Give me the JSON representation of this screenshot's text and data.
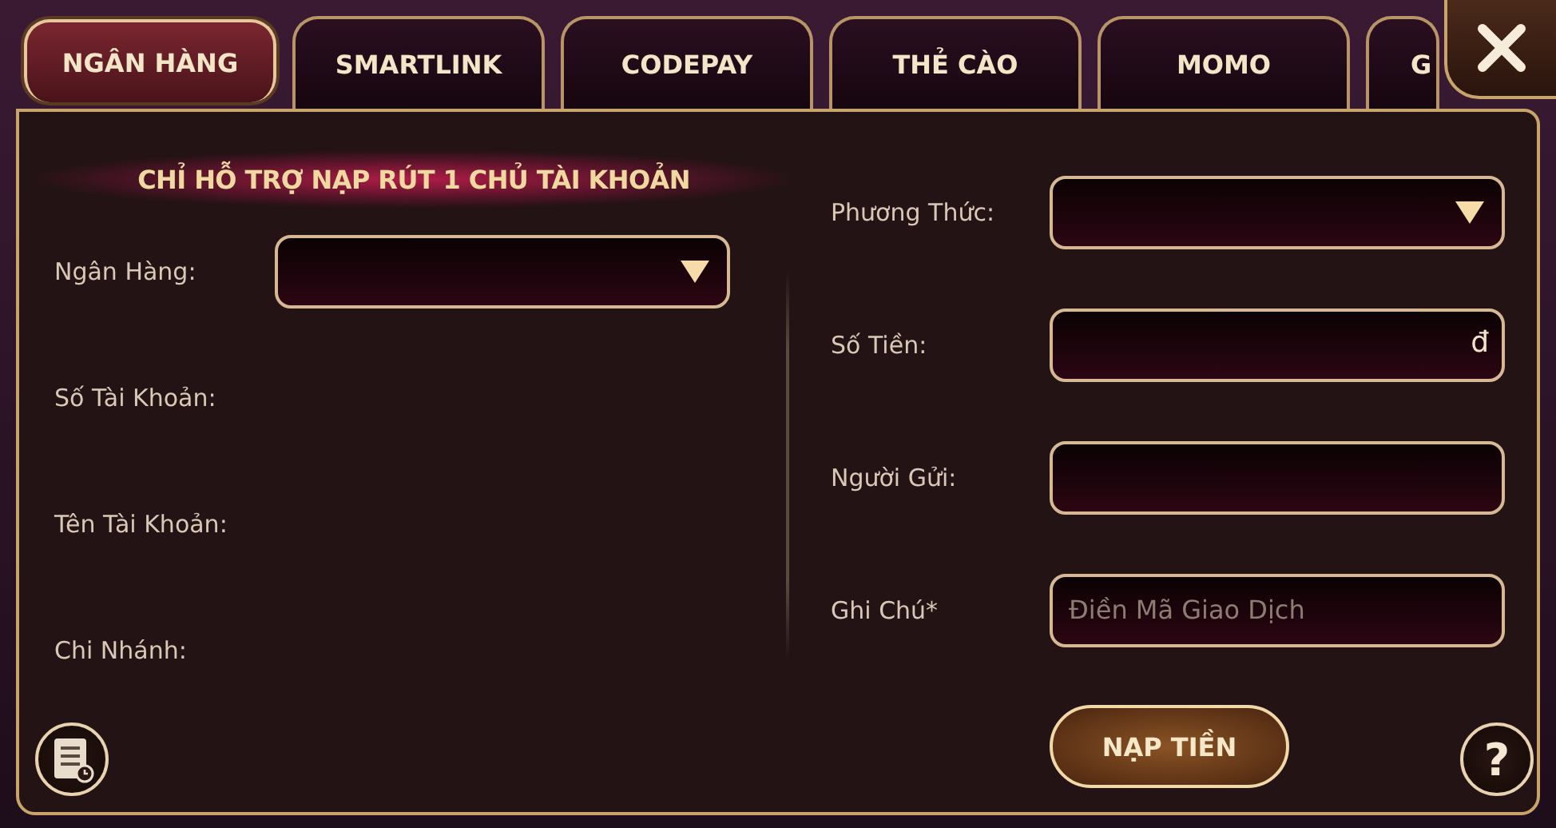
{
  "tabs": [
    {
      "label": "NGÂN HÀNG",
      "selected": true
    },
    {
      "label": "SMARTLINK",
      "selected": false
    },
    {
      "label": "CODEPAY",
      "selected": false
    },
    {
      "label": "THẺ CÀO",
      "selected": false
    },
    {
      "label": "MOMO",
      "selected": false
    },
    {
      "label": "G",
      "selected": false
    }
  ],
  "notice": "CHỈ HỖ TRỢ NẠP RÚT 1 CHỦ TÀI KHOẢN",
  "left_fields": [
    {
      "label": "Ngân Hàng:",
      "kind": "dropdown"
    },
    {
      "label": "Số Tài Khoản:",
      "kind": "info"
    },
    {
      "label": "Tên Tài Khoản:",
      "kind": "info"
    },
    {
      "label": "Chi Nhánh:",
      "kind": "info"
    }
  ],
  "right_fields": [
    {
      "label": "Phương Thức:",
      "kind": "dropdown"
    },
    {
      "label": "Số Tiền:",
      "kind": "input",
      "suffix": "đ"
    },
    {
      "label": "Người Gửi:",
      "kind": "input"
    },
    {
      "label": "Ghi Chú*",
      "kind": "input",
      "placeholder": "Điền Mã Giao Dịch"
    }
  ],
  "submit_button": "NẠP TIỀN",
  "help_button": "?"
}
